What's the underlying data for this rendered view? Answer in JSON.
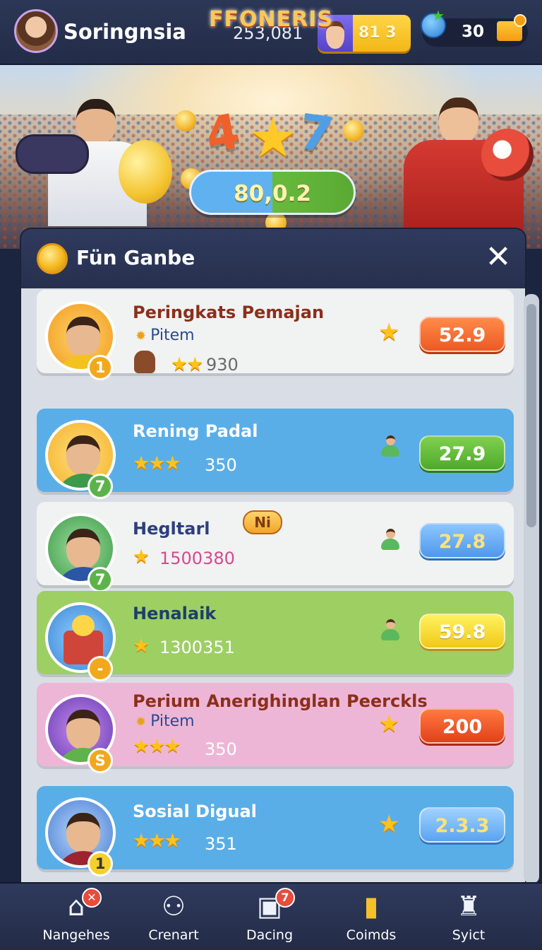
{
  "topbar": {
    "username": "Soringnsia",
    "score": "253,081",
    "hero_value": "81 3",
    "gem_value": "30"
  },
  "banner": {
    "title": "FFONERIS",
    "num_left": "4",
    "num_right": "7",
    "score_pill": "80,0.2"
  },
  "modal": {
    "title": "Fün Ganbe",
    "close_symbol": "✕"
  },
  "rows": [
    {
      "name": "Peringkats Pemajan",
      "sub": "Pitem",
      "stars": "★★",
      "points": "930",
      "rank": "1",
      "value": "52.9"
    },
    {
      "name": "Rening Padal",
      "stars": "★★★",
      "points": "350",
      "rank": "7",
      "value": "27.9"
    },
    {
      "name": "Hegltarl",
      "tag": "Ni",
      "stars": "★",
      "points": "1500380",
      "rank": "7",
      "value": "27.8"
    },
    {
      "name": "Henalaik",
      "stars": "★",
      "points": "1300351",
      "rank": "-",
      "value": "59.8"
    },
    {
      "name": "Perium Anerighinglan Peerckls",
      "sub": "Pitem",
      "stars": "★★★",
      "points": "350",
      "rank": "S",
      "value": "200"
    },
    {
      "name": "Sosial Digual",
      "stars": "★★★",
      "points": "351",
      "rank": "1",
      "value": "2.3.3"
    }
  ],
  "nav": [
    {
      "label": "Nangehes",
      "icon": "home-icon",
      "badge": "✕"
    },
    {
      "label": "Crenart",
      "icon": "people-icon"
    },
    {
      "label": "Dacing",
      "icon": "gift-icon",
      "badge": "7"
    },
    {
      "label": "Coimds",
      "icon": "trophy-stack-icon"
    },
    {
      "label": "Syict",
      "icon": "cup-icon"
    }
  ],
  "colors": {
    "row_white": "#f1f2f2",
    "row_blue": "#5aaee8",
    "row_green": "#9dcf63",
    "row_pink": "#eeb6d6",
    "accent_orange": "#ec5a23"
  }
}
